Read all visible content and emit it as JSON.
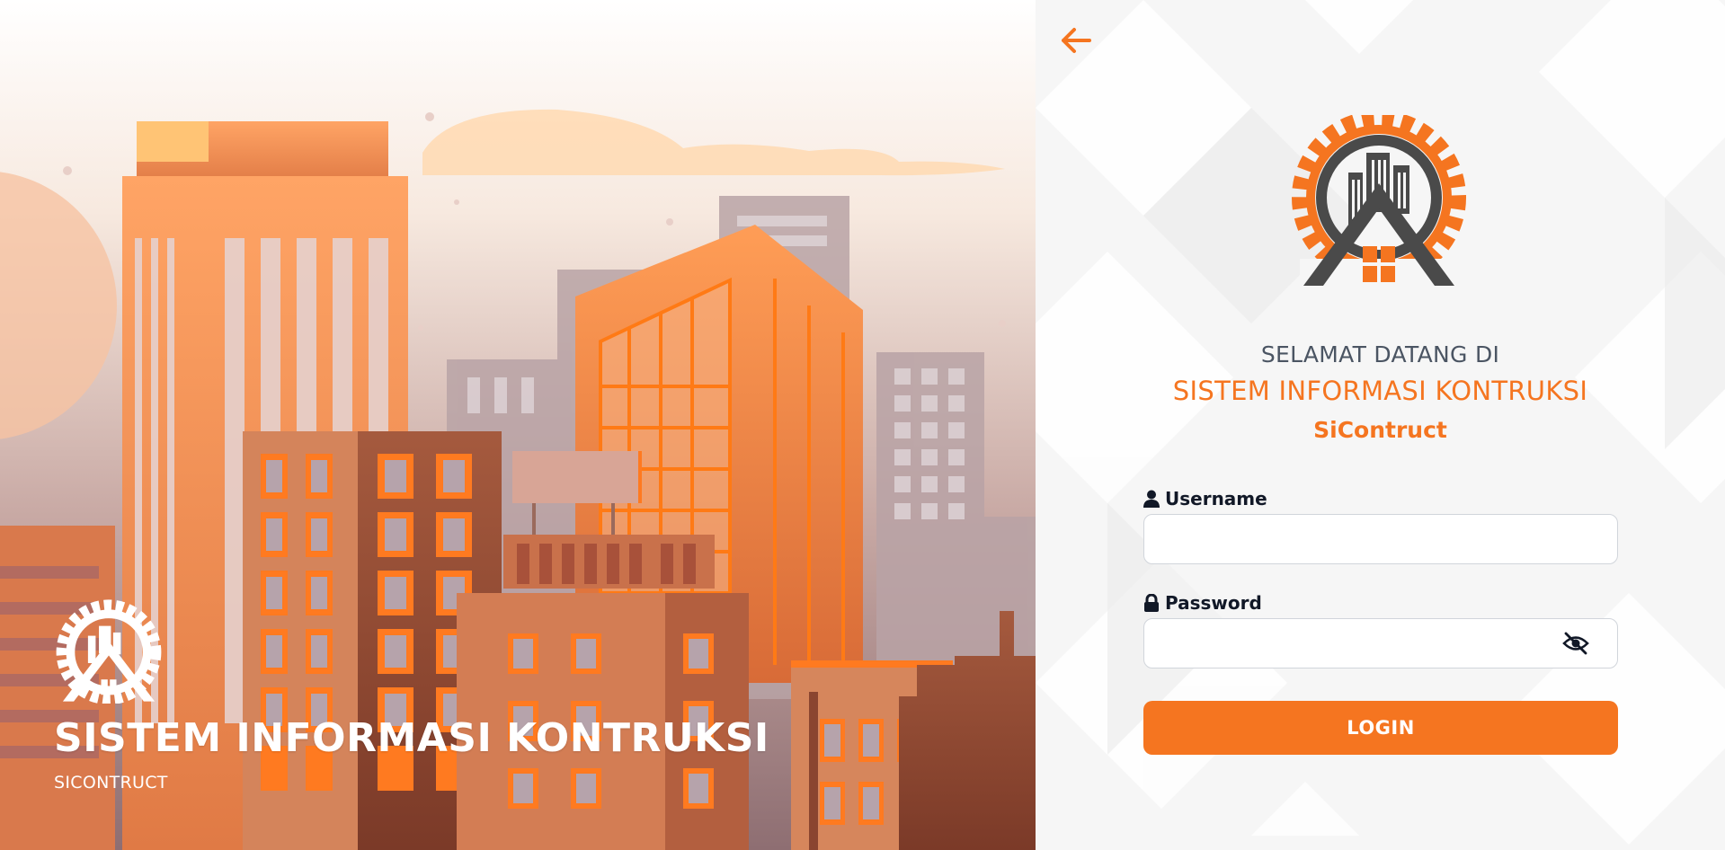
{
  "left": {
    "title": "SISTEM INFORMASI KONTRUKSI",
    "subtitle": "SICONTRUCT",
    "logo": "construction-gear-house-logo-white"
  },
  "right": {
    "back_icon": "arrow-left-icon",
    "logo": "construction-gear-house-logo",
    "welcome_line1": "SELAMAT DATANG DI",
    "welcome_line2": "SISTEM INFORMASI KONTRUKSI",
    "welcome_line3": "SiContruct",
    "username": {
      "label": "Username",
      "icon": "user-icon",
      "value": ""
    },
    "password": {
      "label": "Password",
      "icon": "lock-icon",
      "value": "",
      "toggle_icon": "eye-slash-icon"
    },
    "login_label": "LOGIN"
  },
  "colors": {
    "accent": "#f57520",
    "text_dark": "#111827",
    "text_gray": "#4b5563",
    "logo_gray": "#4a4a4a"
  }
}
